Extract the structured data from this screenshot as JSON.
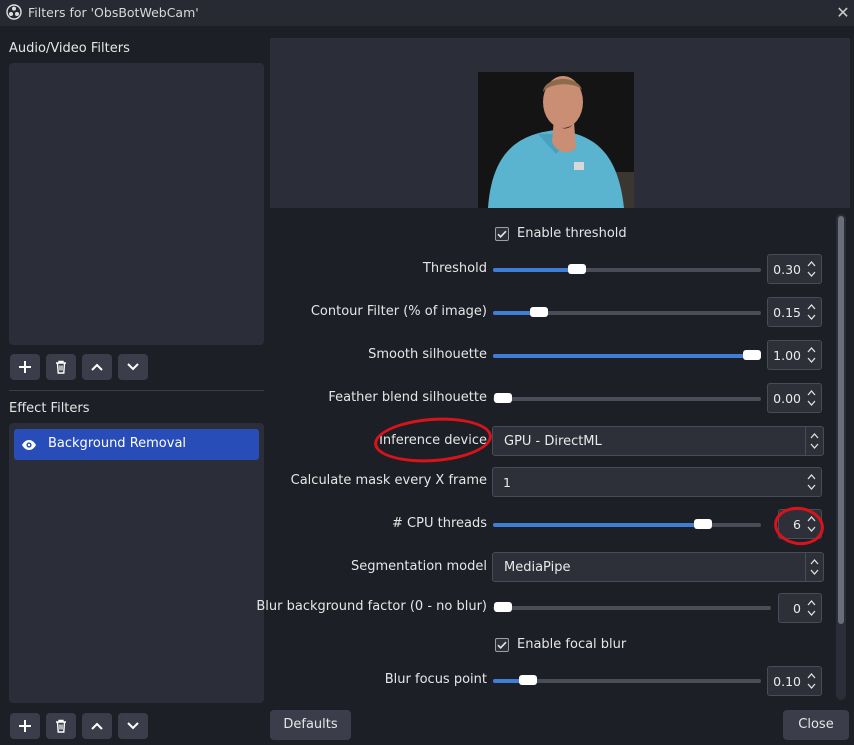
{
  "window": {
    "title": "Filters for 'ObsBotWebCam'",
    "close_icon": "close-icon"
  },
  "left": {
    "av_filters_label": "Audio/Video Filters",
    "effect_filters_label": "Effect Filters",
    "effect_filters": [
      {
        "name": "Background Removal",
        "icon": "eye-icon",
        "selected": true
      }
    ],
    "toolbar_icons": [
      "add-icon",
      "trash-icon",
      "move-up-icon",
      "move-down-icon"
    ]
  },
  "props": {
    "enable_threshold": {
      "label": "Enable threshold",
      "checked": true
    },
    "threshold": {
      "label": "Threshold",
      "value": "0.30",
      "fill": 0.3
    },
    "contour": {
      "label": "Contour Filter (% of image)",
      "value": "0.15",
      "fill": 0.15
    },
    "smooth": {
      "label": "Smooth silhouette",
      "value": "1.00",
      "fill": 1.0
    },
    "feather": {
      "label": "Feather blend silhouette",
      "value": "0.00",
      "fill": 0.0
    },
    "inference": {
      "label": "Inference device",
      "value": "GPU - DirectML"
    },
    "calc_mask": {
      "label": "Calculate mask every X frame",
      "value": "1"
    },
    "cpu_threads": {
      "label": "# CPU threads",
      "value": "6",
      "fill": 0.78
    },
    "segmentation": {
      "label": "Segmentation model",
      "value": "MediaPipe"
    },
    "blur_bg": {
      "label": "Blur background factor (0 - no blur)",
      "value": "0",
      "fill": 0.0
    },
    "enable_focal": {
      "label": "Enable focal blur",
      "checked": true
    },
    "focus_point": {
      "label": "Blur focus point",
      "value": "0.10",
      "fill": 0.1
    }
  },
  "buttons": {
    "defaults": "Defaults",
    "close": "Close"
  },
  "colors": {
    "accent": "#284cb8",
    "slider_fill": "#3f7dd6",
    "annotation": "#d8141a"
  }
}
